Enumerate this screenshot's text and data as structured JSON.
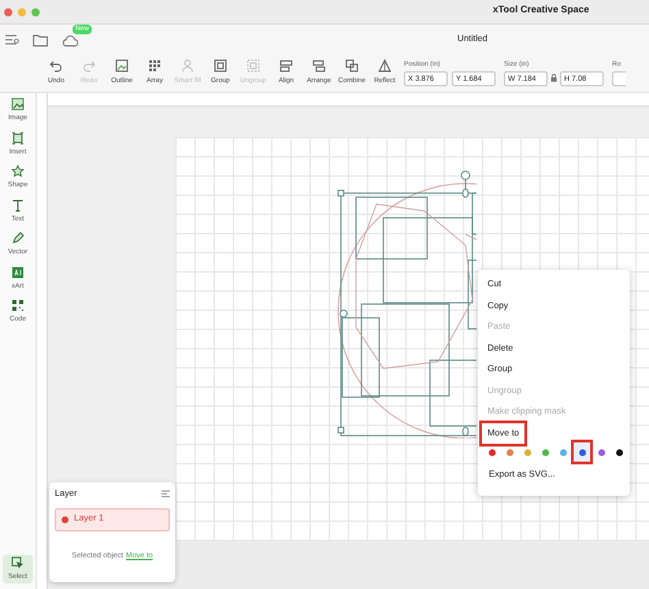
{
  "window": {
    "title": "xTool Creative Space"
  },
  "topbar": {
    "badge": "New",
    "document_title": "Untitled"
  },
  "toolbar": {
    "tools": [
      {
        "label": "Undo",
        "disabled": false
      },
      {
        "label": "Redo",
        "disabled": true
      },
      {
        "label": "Outline",
        "disabled": false
      },
      {
        "label": "Array",
        "disabled": false
      },
      {
        "label": "Smart fill",
        "disabled": true
      },
      {
        "label": "Group",
        "disabled": false
      },
      {
        "label": "Ungroup",
        "disabled": true
      },
      {
        "label": "Align",
        "disabled": false
      },
      {
        "label": "Arrange",
        "disabled": false
      },
      {
        "label": "Combine",
        "disabled": false
      },
      {
        "label": "Reflect",
        "disabled": false
      }
    ],
    "position": {
      "label": "Position (in)",
      "x": "X 3.876",
      "y": "Y 1.684"
    },
    "size": {
      "label": "Size (in)",
      "w": "W 7.184",
      "h": "H 7.08"
    },
    "rotation_label": "Ro"
  },
  "sidebar": {
    "items": [
      {
        "label": "Image",
        "selected": false
      },
      {
        "label": "Insert",
        "selected": false
      },
      {
        "label": "Shape",
        "selected": false
      },
      {
        "label": "Text",
        "selected": false
      },
      {
        "label": "Vector",
        "selected": false
      },
      {
        "label": "xArt",
        "selected": false
      },
      {
        "label": "Code",
        "selected": false
      }
    ],
    "bottom_items": [
      {
        "label": "Select",
        "selected": true
      }
    ]
  },
  "layer_panel": {
    "title": "Layer",
    "layers": [
      {
        "name": "Layer 1",
        "selected": true,
        "color": "#e0403a"
      }
    ],
    "footer": "Selected object",
    "link": "Move to"
  },
  "context_menu": {
    "items": [
      {
        "label": "Cut",
        "disabled": false,
        "annotated": false
      },
      {
        "label": "Copy",
        "disabled": false,
        "annotated": false
      },
      {
        "label": "Paste",
        "disabled": true,
        "annotated": false
      },
      {
        "label": "Delete",
        "disabled": false,
        "annotated": false
      },
      {
        "label": "Group",
        "disabled": false,
        "annotated": false
      },
      {
        "label": "Ungroup",
        "disabled": true,
        "annotated": false
      },
      {
        "label": "Make clipping mask",
        "disabled": true,
        "annotated": false
      },
      {
        "label": "Move to",
        "disabled": false,
        "annotated": true
      }
    ],
    "colors": [
      {
        "color": "#e02b2b",
        "selected": false
      },
      {
        "color": "#e8804a",
        "selected": false
      },
      {
        "color": "#d9b23a",
        "selected": false
      },
      {
        "color": "#4fb84a",
        "selected": false
      },
      {
        "color": "#5aaee8",
        "selected": false
      },
      {
        "color": "#2f5fe0",
        "selected": true
      },
      {
        "color": "#9b5ee0",
        "selected": false
      },
      {
        "color": "#111111",
        "selected": false
      }
    ],
    "footer_item": "Export as SVG..."
  }
}
